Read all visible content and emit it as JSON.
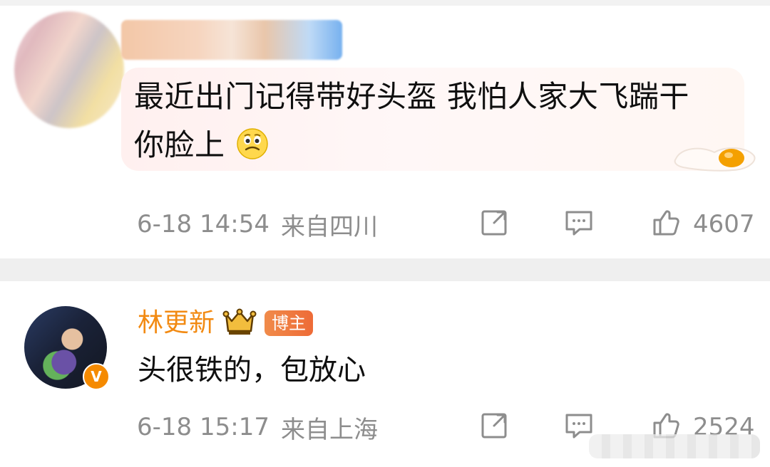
{
  "comment_1": {
    "text_line_1": "最近出门记得带好头盔 我怕人家大飞踹干",
    "text_line_2": "你脸上",
    "time": "6-18 14:54",
    "location": "来自四川",
    "like_count": "4607"
  },
  "comment_2": {
    "username": "林更新",
    "badge": "博主",
    "text": "头很铁的，包放心",
    "time": "6-18 15:17",
    "location": "来自上海",
    "like_count": "2524"
  },
  "icons": {
    "share": "share-icon",
    "comment": "comment-icon",
    "like": "like-icon",
    "crown": "crown-icon",
    "emoji": "sad-emoji-icon",
    "verified": "verified-badge"
  },
  "colors": {
    "username": "#f28a12",
    "meta": "#8d8d8d",
    "bubble_bg": "#fff3f3",
    "separator": "#efefef",
    "badge_bg": "#f08b4a"
  }
}
